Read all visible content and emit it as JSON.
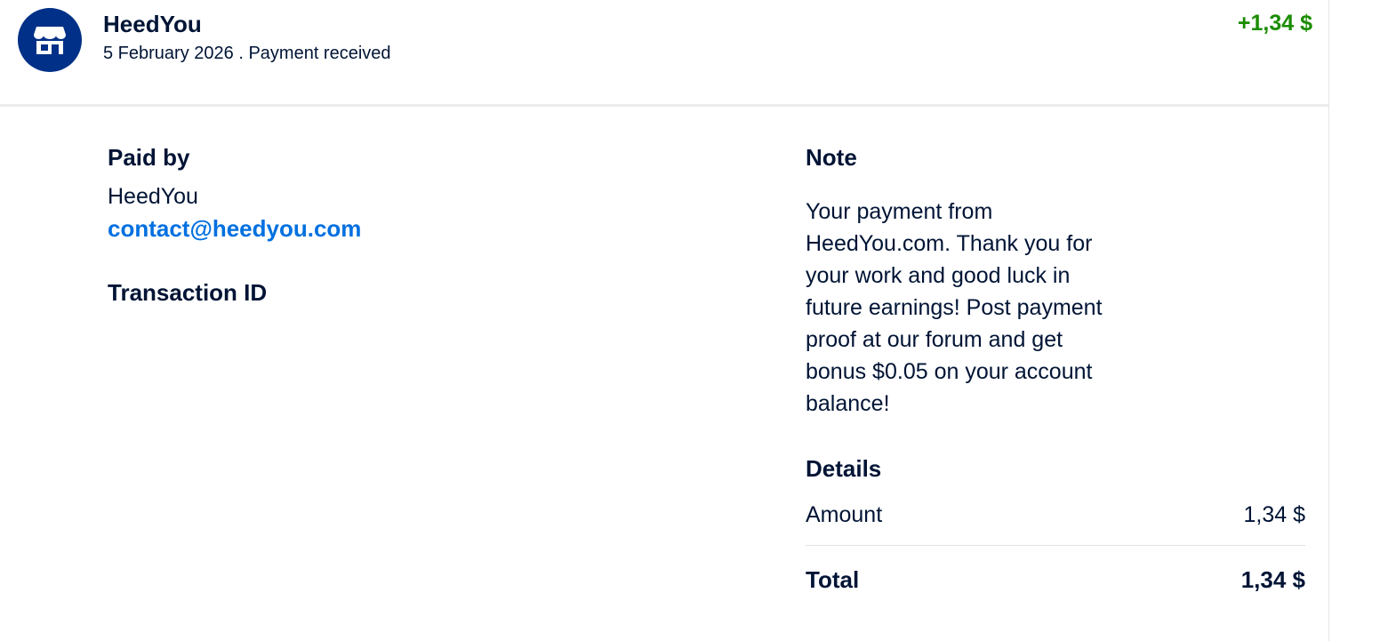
{
  "header": {
    "merchant_name": "HeedYou",
    "date": "5 February 2026",
    "separator": ".",
    "status": "Payment received",
    "amount": "+1,34 $"
  },
  "paid_by": {
    "title": "Paid by",
    "name": "HeedYou",
    "email": "contact@heedyou.com"
  },
  "transaction": {
    "title": "Transaction ID"
  },
  "note": {
    "title": "Note",
    "text": "Your payment from HeedYou.com. Thank you for your work and good luck in future earnings! Post payment proof at our forum and get bonus $0.05 on your account balance!"
  },
  "details": {
    "title": "Details",
    "amount_label": "Amount",
    "amount_value": "1,34 $",
    "total_label": "Total",
    "total_value": "1,34 $"
  },
  "icons": {
    "avatar": "store-icon"
  },
  "colors": {
    "brand_navy": "#003087",
    "text": "#001435",
    "positive": "#1a8c00",
    "link": "#0070e0"
  }
}
